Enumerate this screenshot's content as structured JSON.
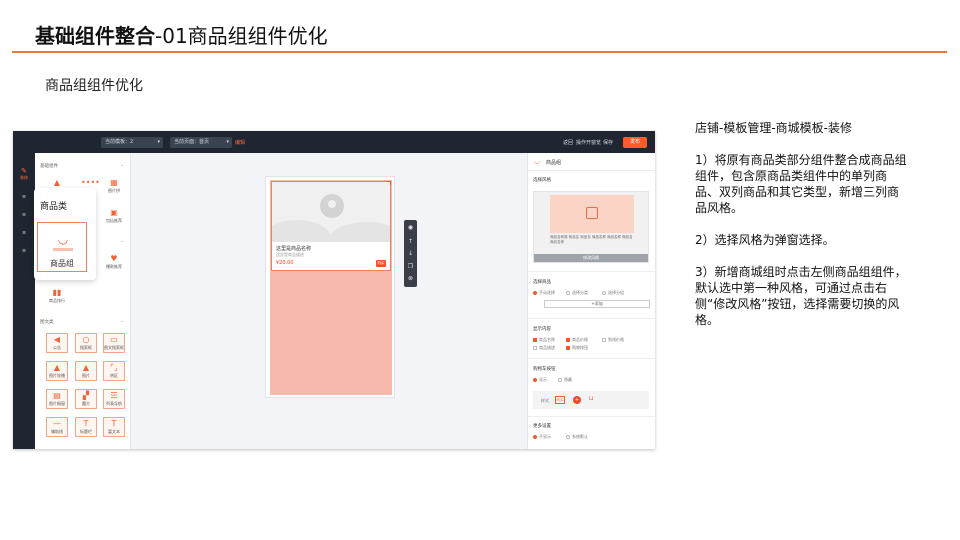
{
  "slide": {
    "title_bold": "基础组件整合",
    "title_rest": "-01商品组组件优化",
    "subtitle": "商品组组件优化"
  },
  "notes": {
    "heading": "店铺-模板管理-商城模板-装修",
    "points": [
      "1）将原有商品类部分组件整合成商品组组件，包含原商品类组件中的单列商品、双列商品和其它类型，新增三列商品风格。",
      "2）选择风格为弹窗选择。",
      "3）新增商城组时点击左侧商品组组件，默认选中第一种风格，可通过点击右侧“修改风格”按钮，选择需要切换的风格。"
    ]
  },
  "app": {
    "topbar": {
      "template_select": "当前模板：2",
      "page_select": "当前页面：首页",
      "badge": "编辑",
      "links": [
        "返回",
        "操作开窗览",
        "保存"
      ],
      "publish": "发布"
    },
    "rail": {
      "active_label": "装修"
    },
    "left_panel": {
      "group_1": "基础组件",
      "group_2": "图文类",
      "tiles_top": [
        {
          "label": "",
          "icon": "shop-icon"
        },
        {
          "label": "",
          "icon": "dots-icon"
        },
        {
          "label": "图片拼",
          "icon": "grid-icon"
        }
      ],
      "tiles_mid": [
        {
          "label": "包括推荐",
          "icon": "bag-icon"
        },
        {
          "label": "爆款推荐",
          "icon": "heart-icon"
        },
        {
          "label": "商品排行",
          "icon": "bars-icon"
        }
      ],
      "tiles_text": [
        {
          "label": "公告",
          "icon": "speaker-icon"
        },
        {
          "label": "搜索框",
          "icon": "search-icon"
        },
        {
          "label": "图文搜索框",
          "icon": "image-search-icon"
        },
        {
          "label": "图片轮播",
          "icon": "carousel-icon"
        },
        {
          "label": "图片",
          "icon": "image-icon"
        },
        {
          "label": "热区",
          "icon": "hotspot-icon"
        },
        {
          "label": "图片橱窗",
          "icon": "window-icon"
        },
        {
          "label": "魔方",
          "icon": "cube-icon"
        },
        {
          "label": "列表导航",
          "icon": "list-icon"
        },
        {
          "label": "辅助线",
          "icon": "line-icon"
        },
        {
          "label": "标题栏",
          "icon": "title-icon"
        },
        {
          "label": "富文本",
          "icon": "text-icon"
        }
      ]
    },
    "popover": {
      "category": "商品类",
      "item": "商品组"
    },
    "preview_card": {
      "title": "这里是商品名称",
      "desc": "这里是商品描述",
      "price": "¥20.00",
      "buy": "购买"
    },
    "right_panel": {
      "title": "商品组",
      "sec_style": "选择风格",
      "style_desc": "商品名称简 商品名 商品名 商品名称 商品名称 商品名 商品名称",
      "style_button": "修改风格",
      "sec_goods": "选择商品",
      "goods_options": [
        "手动选择",
        "选择分类",
        "选择分组"
      ],
      "add_button": "+添加",
      "sec_display": "显示内容",
      "display_options": [
        "商品名称",
        "商品价格",
        "划线价格",
        "商品描述",
        "购物按钮"
      ],
      "sec_buy": "购物车按钮",
      "buy_options": [
        "显示",
        "隐藏"
      ],
      "btn_label": "样式",
      "btn_style_1": "购买",
      "sec_more": "更多设置",
      "more_options": [
        "不显示",
        "系统默认"
      ]
    },
    "colors": {
      "accent": "#f05a2a",
      "dark": "#1f2631",
      "title_rule": "#e8793a"
    }
  }
}
